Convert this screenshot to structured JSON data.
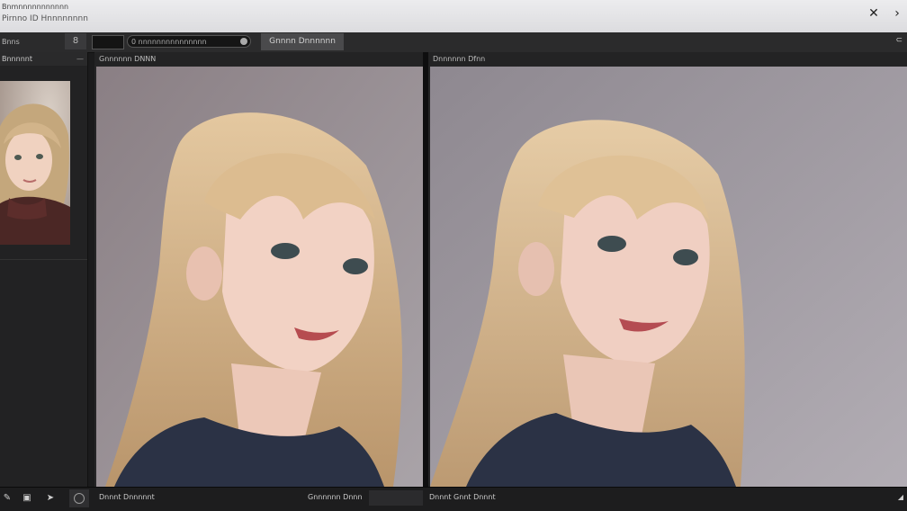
{
  "window": {
    "app_title": "Bnmnnnnnnnnnnn",
    "document_title": "Pirnno ID Hnnnnnnnn"
  },
  "toolbar": {
    "left_label": "Bnns",
    "tool_label": "8",
    "search_text": "0 nnnnnnnnnnnnnnn",
    "generate_label": "Gnnnn Dnnnnnn",
    "right_label": "⊂"
  },
  "sidebar": {
    "header_label": "Bnnnnnt",
    "collapse_label": "—"
  },
  "panels": [
    {
      "label": "Gnnnnnn DNNN"
    },
    {
      "label": "Dnnnnnn Dfnn"
    }
  ],
  "bottombar": {
    "label_1": "Dnnnt Dnnnnnt",
    "label_2": "Gnnnnnn Dnnn",
    "field_value": "",
    "label_3": "Dnnnt Gnnt Dnnnt",
    "corner_label": "◢"
  },
  "colors": {
    "window_bg": "#1b1b1c",
    "panel_bg": "#252526",
    "backdrop": "#8e8a8e",
    "hair": "#cdb08a",
    "shirt": "#2a3244"
  },
  "icons": [
    "close-icon",
    "chevron-right-icon",
    "brush-icon",
    "save-icon",
    "cursor-icon",
    "record-icon",
    "search-icon"
  ]
}
